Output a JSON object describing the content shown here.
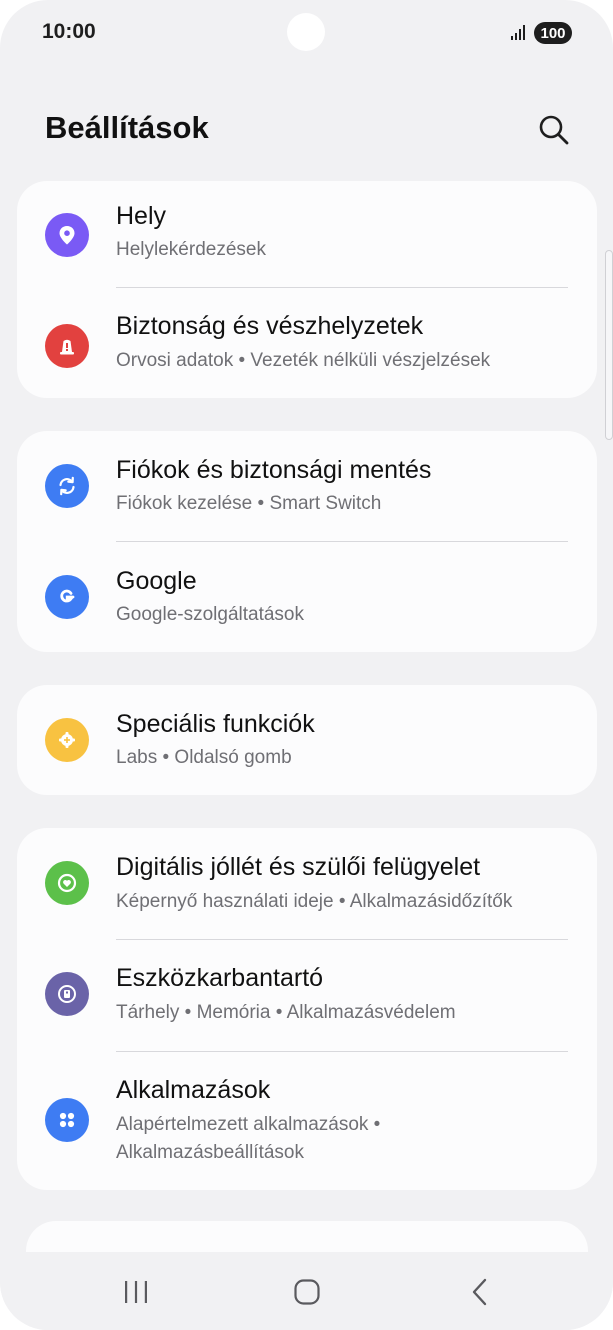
{
  "status_bar": {
    "time": "10:00",
    "battery": "100",
    "signal_icon": "signal-bars-icon"
  },
  "header": {
    "title": "Beállítások",
    "search_icon": "search-icon"
  },
  "colors": {
    "background": "#f1f1f3",
    "card": "#fcfcfd",
    "location": "#7a5af5",
    "safety": "#e2413f",
    "accounts": "#3e7cf3",
    "google": "#3e7cf3",
    "advanced": "#f8c241",
    "wellbeing": "#5cc04a",
    "device_care": "#6a63a8",
    "apps": "#3e7cf3"
  },
  "groups": [
    {
      "items": [
        {
          "title": "Hely",
          "subtitle": "Helylekérdezések",
          "icon": "location-pin-icon"
        },
        {
          "title": "Biztonság és vészhelyzetek",
          "subtitle": "Orvosi adatok  •  Vezeték nélküli vészjelzések",
          "icon": "emergency-siren-icon"
        }
      ]
    },
    {
      "items": [
        {
          "title": "Fiókok és biztonsági mentés",
          "subtitle": "Fiókok kezelése  •  Smart Switch",
          "icon": "sync-arrows-icon"
        },
        {
          "title": "Google",
          "subtitle": "Google-szolgáltatások",
          "icon": "google-g-icon"
        }
      ]
    },
    {
      "items": [
        {
          "title": "Speciális funkciók",
          "subtitle": "Labs  •  Oldalsó gomb",
          "icon": "gear-plus-icon"
        }
      ]
    },
    {
      "items": [
        {
          "title": "Digitális jóllét és szülői felügyelet",
          "subtitle": "Képernyő használati ideje  •  Alkalmazásidőzítők",
          "icon": "heart-circle-icon"
        },
        {
          "title": "Eszközkarbantartó",
          "subtitle": "Tárhely  •  Memória  •  Alkalmazásvédelem",
          "icon": "device-care-icon"
        },
        {
          "title": "Alkalmazások",
          "subtitle": "Alapértelmezett alkalmazások  •",
          "subtitle2": "Alkalmazásbeállítások",
          "icon": "apps-grid-icon"
        }
      ]
    }
  ],
  "nav": {
    "recents_icon": "recents-icon",
    "home_icon": "home-icon",
    "back_icon": "back-icon"
  }
}
